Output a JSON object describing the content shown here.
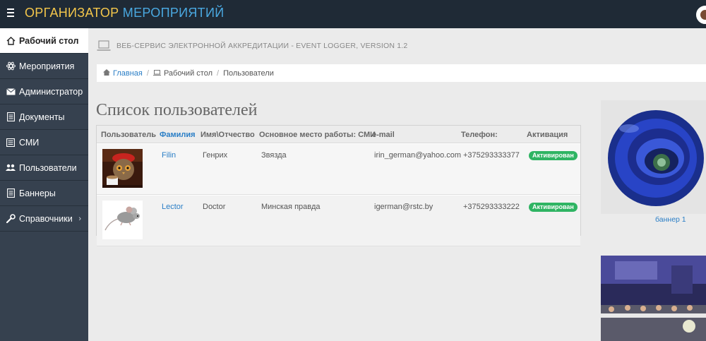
{
  "app": {
    "brand_part1": "ОРГАНИЗАТОР",
    "brand_part2": "МЕРОПРИЯТИЙ",
    "header_title": "ВЕБ-СЕРВИС ЭЛЕКТРОННОЙ АККРЕДИТАЦИИ - EVENT LOGGER, VERSION 1.2"
  },
  "colors": {
    "topbar": "#1f2a36",
    "sidebar": "#36414f",
    "brand_yellow": "#f3c64b",
    "brand_blue": "#4aa8e0",
    "link": "#2a7ec6",
    "badge_green": "#2fb463"
  },
  "sidebar": {
    "items": [
      {
        "label": "Рабочий стол",
        "icon": "home-icon"
      },
      {
        "label": "Мероприятия",
        "icon": "atom-icon"
      },
      {
        "label": "Администратор",
        "icon": "envelope-icon"
      },
      {
        "label": "Документы",
        "icon": "document-icon"
      },
      {
        "label": "СМИ",
        "icon": "newspaper-icon"
      },
      {
        "label": "Пользователи",
        "icon": "users-icon"
      },
      {
        "label": "Баннеры",
        "icon": "list-icon"
      },
      {
        "label": "Справочники",
        "icon": "wrench-icon"
      }
    ]
  },
  "breadcrumb": {
    "home": "Главная",
    "desk": "Рабочий стол",
    "current": "Пользователи"
  },
  "page": {
    "title": "Список пользователей"
  },
  "table": {
    "headers": [
      "Пользователь",
      "Фамилия",
      "Имя\\Отчество",
      "Основное место работы: СМИ",
      "e-mail",
      "Телефон:",
      "Активация"
    ],
    "rows": [
      {
        "surname": "Filin",
        "name": "Генрих",
        "media": "Звязда",
        "email": "irin_german@yahoo.com",
        "phone": "+375293333377",
        "status": "Активирован"
      },
      {
        "surname": "Lector",
        "name": "Doctor",
        "media": "Минская правда",
        "email": "igerman@rstc.by",
        "phone": "+375293333222",
        "status": "Активирован"
      }
    ]
  },
  "banners": {
    "banner1_caption": "баннер 1"
  }
}
